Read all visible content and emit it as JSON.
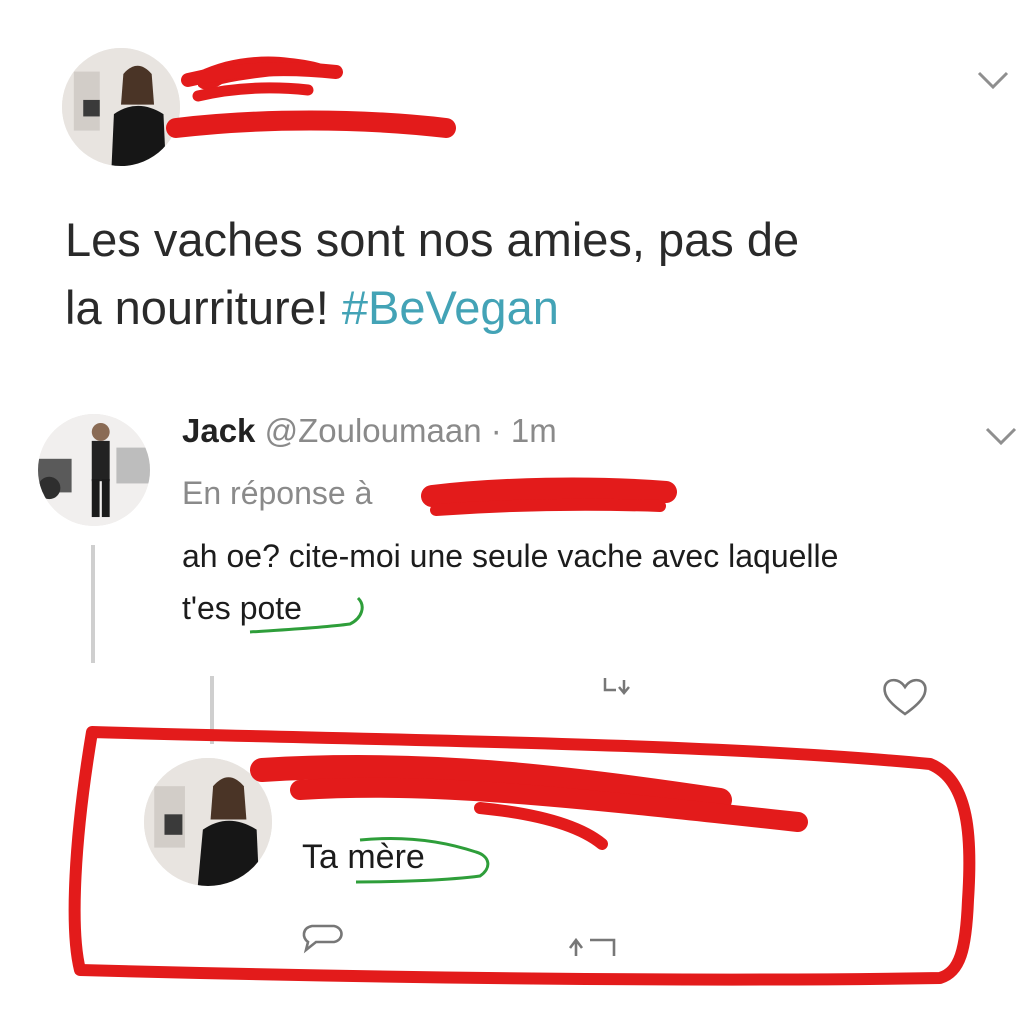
{
  "original_tweet": {
    "text_line1": "Les vaches sont nos amies, pas de",
    "text_line2": "la nourriture! ",
    "hashtag": "#BeVegan"
  },
  "reply_tweet": {
    "author_name": "Jack",
    "author_handle": "@Zouloumaan",
    "separator": " · ",
    "time": "1m",
    "in_reply_to": "En réponse à",
    "text_line1": "ah oe? cite-moi une seule vache avec laquelle",
    "text_prefix": "t'es ",
    "text_underlined": "pote"
  },
  "final_reply": {
    "text_prefix": "Ta ",
    "text_underlined": "mère"
  },
  "icons": {
    "menu": "chevron-down-icon",
    "reply": "reply-icon",
    "retweet": "retweet-icon",
    "like": "heart-icon"
  },
  "colors": {
    "redaction": "#e31b1b",
    "hashtag": "#43a3b6",
    "annotation_green": "#2e9e3a"
  }
}
